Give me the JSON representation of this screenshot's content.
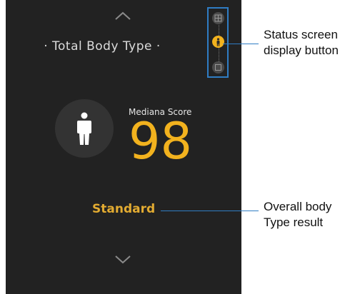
{
  "header": {
    "up_icon": "chevron-up-icon",
    "title": "· Total Body Type ·"
  },
  "view_selector": {
    "buttons": [
      {
        "icon": "grid-icon",
        "active": false
      },
      {
        "icon": "person-icon",
        "active": true
      },
      {
        "icon": "square-icon",
        "active": false
      }
    ]
  },
  "score": {
    "label": "Mediana Score",
    "value": "98",
    "avatar_icon": "body-figure-icon"
  },
  "result": {
    "text": "Standard"
  },
  "footer": {
    "down_icon": "chevron-down-icon"
  },
  "annotations": {
    "status_button": [
      "Status screen",
      "display button"
    ],
    "body_result": [
      "Overall body",
      "Type result"
    ]
  },
  "colors": {
    "background": "#222222",
    "accent": "#f2b21e",
    "callout_line": "#2f7dc4"
  }
}
